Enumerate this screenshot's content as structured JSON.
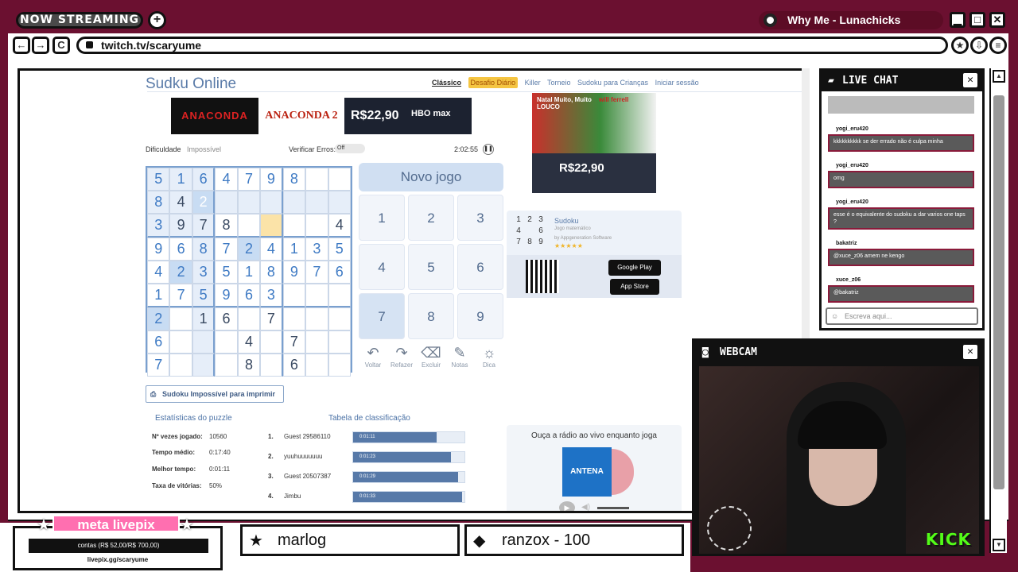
{
  "overlay": {
    "now_streaming": "NOW STREAMING",
    "plus": "+",
    "song": "Why Me - Lunachicks",
    "win_min": "▁",
    "win_max": "□",
    "win_close": "✕"
  },
  "browser": {
    "back": "←",
    "forward": "→",
    "reload": "C",
    "url": "twitch.tv/scaryume"
  },
  "sudoku": {
    "logo_a": "Sud",
    "logo_b": "ku Online",
    "nav": [
      "Clássico",
      "Desafio Diário",
      "Killer",
      "Torneio",
      "Sudoku para Crianças",
      "Iniciar sessão"
    ],
    "ad1": "ANACONDA",
    "ad2": "ANACONDA 2",
    "ad3_price": "R$22,90",
    "ad3_brand": "HBO max",
    "difficulty_label": "Dificuldade",
    "difficulty_value": "Impossível",
    "verify_label": "Verificar Erros:",
    "verify_value": "Off",
    "timer": "2:02:55",
    "new_game": "Novo jogo",
    "numpad": [
      "1",
      "2",
      "3",
      "4",
      "5",
      "6",
      "7",
      "8",
      "9"
    ],
    "tools": [
      "Voltar",
      "Refazer",
      "Excluir",
      "Notas",
      "Dica"
    ],
    "print": "Sudoku Impossível para imprimir",
    "stats_title": "Estatísticas do puzzle",
    "stats": [
      {
        "label": "Nº vezes jogado:",
        "value": "10560"
      },
      {
        "label": "Tempo médio:",
        "value": "0:17:40"
      },
      {
        "label": "Melhor tempo:",
        "value": "0:01:11"
      },
      {
        "label": "Taxa de vitórias:",
        "value": "50%"
      }
    ],
    "leader_title": "Tabela de classificação",
    "leaders": [
      {
        "rank": "1.",
        "name": "Guest 29586110",
        "time": "0:01:11",
        "pct": 75
      },
      {
        "rank": "2.",
        "name": "yuuhuuuuuuu",
        "time": "0:01:23",
        "pct": 88
      },
      {
        "rank": "3.",
        "name": "Guest 20507387",
        "time": "0:01:29",
        "pct": 94
      },
      {
        "rank": "4.",
        "name": "Jimbu",
        "time": "0:01:33",
        "pct": 98
      }
    ],
    "app_name": "Sudoku",
    "app_sub": "Jogo matemático",
    "app_dev": "by Appgeneration Software",
    "google_play": "Google Play",
    "app_store": "App Store",
    "radio_title": "Ouça a rádio ao vivo enquanto joga",
    "radio_name": "ANTENA",
    "side_ad_title": "Natal Muito, Muito LOUCO",
    "side_ad_actor": "will ferrell",
    "side_ad_price": "R$22,90"
  },
  "grid": [
    [
      "5",
      "1",
      "6",
      "4",
      "7",
      "9",
      "8",
      "",
      ""
    ],
    [
      "8",
      "4",
      "2",
      "",
      "",
      "",
      "",
      "",
      ""
    ],
    [
      "3",
      "9",
      "7",
      "8",
      "",
      "",
      "",
      "",
      "4"
    ],
    [
      "9",
      "6",
      "8",
      "7",
      "2",
      "4",
      "1",
      "3",
      "5"
    ],
    [
      "4",
      "2",
      "3",
      "5",
      "1",
      "8",
      "9",
      "7",
      "6"
    ],
    [
      "1",
      "7",
      "5",
      "9",
      "6",
      "3",
      "",
      "",
      ""
    ],
    [
      "2",
      "",
      "1",
      "6",
      "",
      "7",
      "",
      "",
      ""
    ],
    [
      "6",
      "",
      "",
      "",
      "4",
      "",
      "7",
      "",
      ""
    ],
    [
      "7",
      "",
      "",
      "",
      "8",
      "",
      "6",
      "",
      ""
    ]
  ],
  "chat": {
    "title": "LIVE CHAT",
    "messages": [
      {
        "user": "yogi_eru420",
        "text": "kkkkkkkkkk se der errado não é culpa minha"
      },
      {
        "user": "yogi_eru420",
        "text": "omg"
      },
      {
        "user": "yogi_eru420",
        "text": "esse é o equivalente do sudoku a dar varios one taps ?"
      },
      {
        "user": "bakatriz",
        "text": "@xuce_z06 amem ne kengo"
      },
      {
        "user": "xuce_z06",
        "text": "@bakatriz"
      }
    ],
    "input_placeholder": "Escreva aqui..."
  },
  "webcam": {
    "title": "WEBCAM",
    "brand": "KICK"
  },
  "bottom": {
    "goal_title": "meta livepix",
    "goal_text": "contas (R$ 52,00/R$ 700,00)",
    "goal_url": "livepix.gg/scaryume",
    "ticker1": "marlog",
    "ticker2": "ranzox - 100"
  },
  "colors": {
    "frame": "#6b1030",
    "accent_blue": "#5a7ba8",
    "selected_cell": "#f4b740",
    "kick_green": "#53fc18",
    "goal_pink": "#ff6fb0"
  }
}
